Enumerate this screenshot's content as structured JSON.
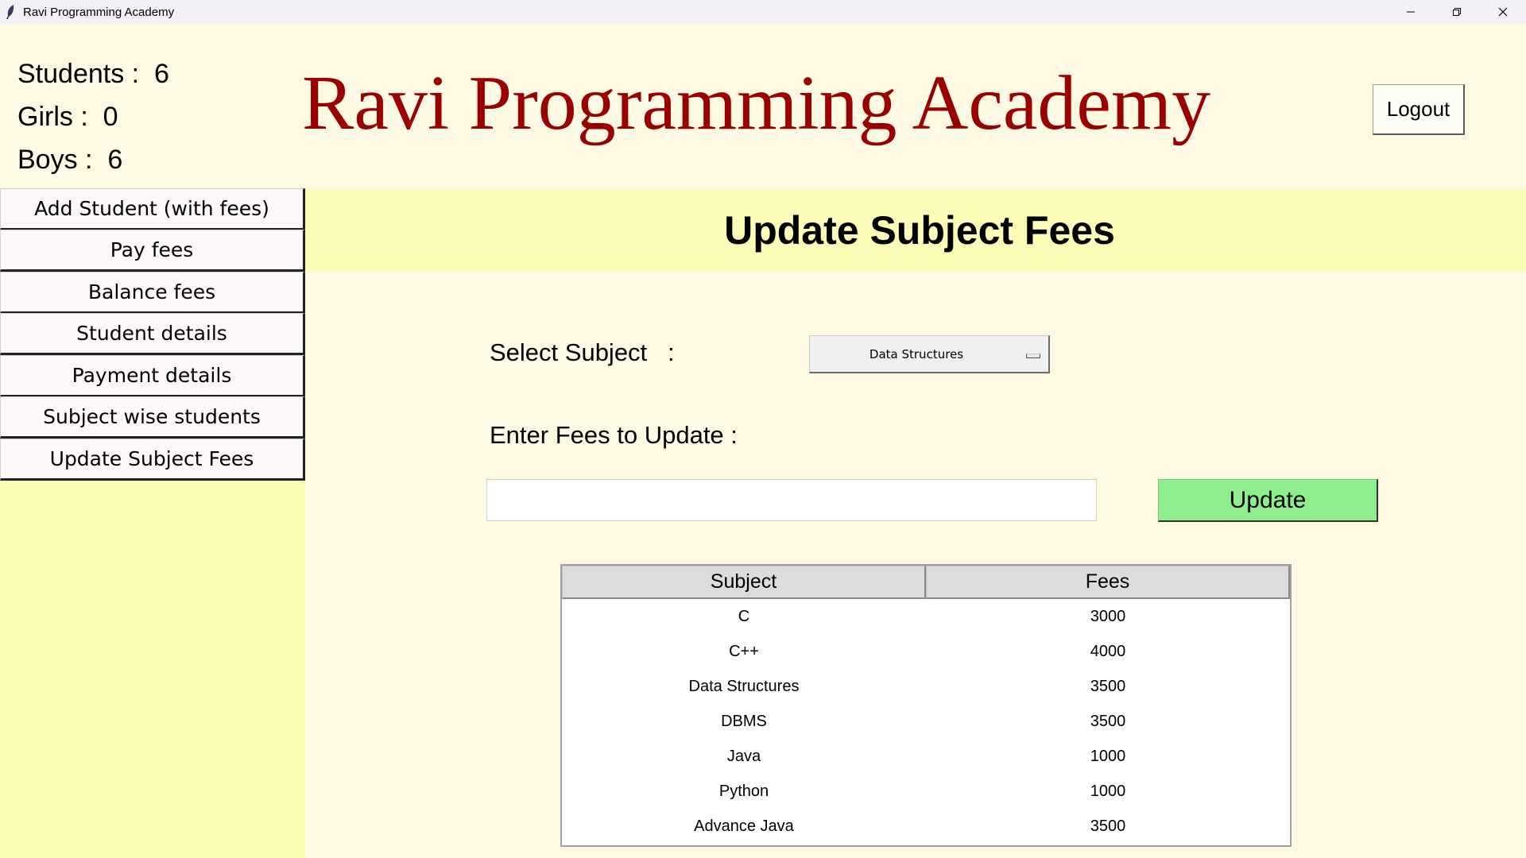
{
  "window": {
    "title": "Ravi Programming Academy",
    "controls": [
      "minimize-icon",
      "restore-icon",
      "close-icon"
    ]
  },
  "header": {
    "stats": {
      "students": "Students :  6",
      "girls": "Girls :  0",
      "boys": "Boys :  6"
    },
    "brand_title": "Ravi Programming Academy",
    "logout_label": "Logout"
  },
  "sidebar": {
    "items": [
      {
        "label": "Add Student (with fees)"
      },
      {
        "label": "Pay fees"
      },
      {
        "label": "Balance fees"
      },
      {
        "label": "Student details"
      },
      {
        "label": "Payment details"
      },
      {
        "label": "Subject wise students"
      },
      {
        "label": "Update Subject Fees"
      }
    ]
  },
  "main": {
    "page_title": "Update Subject Fees",
    "select_label": "Select Subject   :",
    "selected_subject": "Data Structures",
    "fees_label": "Enter Fees to Update :",
    "fees_value": "",
    "update_label": "Update",
    "table": {
      "columns": [
        "Subject",
        "Fees"
      ],
      "rows": [
        [
          "C",
          "3000"
        ],
        [
          "C++",
          "4000"
        ],
        [
          "Data Structures",
          "3500"
        ],
        [
          "DBMS",
          "3500"
        ],
        [
          "Java",
          "1000"
        ],
        [
          "Python",
          "1000"
        ],
        [
          "Advance Java",
          "3500"
        ]
      ]
    }
  },
  "colors": {
    "brand_title": "#990000",
    "background": "#fdf9e2",
    "sidebar_bg": "#fdfcb3",
    "header_band": "#fdfbb8",
    "update_button": "#8eee8e"
  }
}
